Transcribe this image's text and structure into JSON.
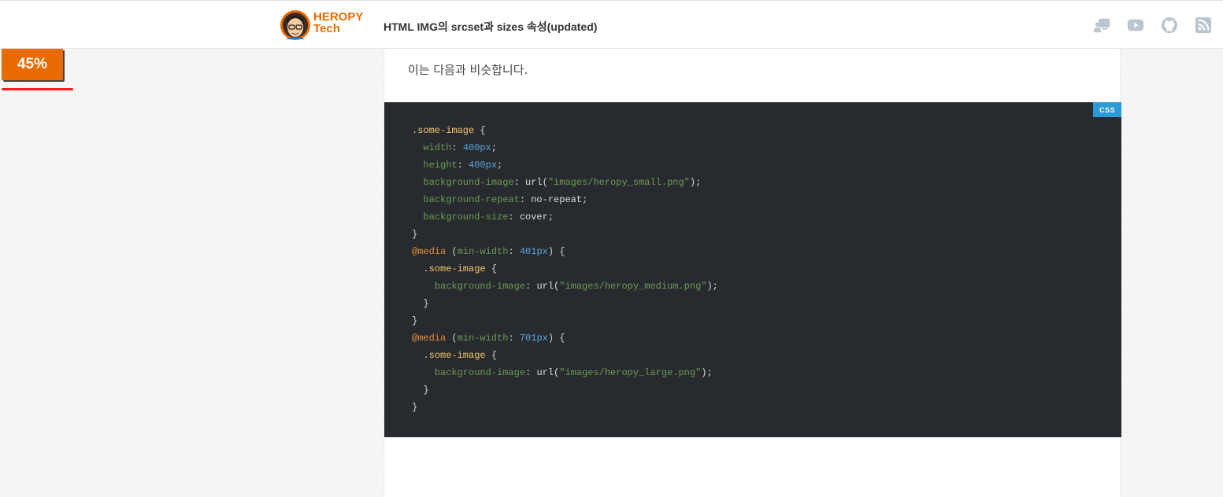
{
  "site": {
    "brand_line1": "HEROPY",
    "brand_line2": "Tech",
    "brand_color": "#e86b00"
  },
  "header": {
    "title": "HTML IMG의 srcset과 sizes 속성(updated)"
  },
  "nav_icons": [
    "presentation-icon",
    "youtube-icon",
    "github-icon",
    "rss-icon"
  ],
  "progress": {
    "label": "45%",
    "value": 45
  },
  "content": {
    "intro": "이는 다음과 비슷합니다.",
    "code": {
      "lang": "CSS",
      "lines": [
        [
          {
            "t": ".some-image",
            "c": "sel"
          },
          {
            "t": " {",
            "c": "pun"
          }
        ],
        [
          {
            "t": "  width",
            "c": "prop"
          },
          {
            "t": ": ",
            "c": "pun"
          },
          {
            "t": "400px",
            "c": "num"
          },
          {
            "t": ";",
            "c": "pun"
          }
        ],
        [
          {
            "t": "  height",
            "c": "prop"
          },
          {
            "t": ": ",
            "c": "pun"
          },
          {
            "t": "400px",
            "c": "num"
          },
          {
            "t": ";",
            "c": "pun"
          }
        ],
        [
          {
            "t": "  background-image",
            "c": "prop"
          },
          {
            "t": ": ",
            "c": "pun"
          },
          {
            "t": "url(",
            "c": "fn"
          },
          {
            "t": "\"images/heropy_small.png\"",
            "c": "str"
          },
          {
            "t": ");",
            "c": "pun"
          }
        ],
        [
          {
            "t": "  background-repeat",
            "c": "prop"
          },
          {
            "t": ": ",
            "c": "pun"
          },
          {
            "t": "no-repeat",
            "c": "fn"
          },
          {
            "t": ";",
            "c": "pun"
          }
        ],
        [
          {
            "t": "  background-size",
            "c": "prop"
          },
          {
            "t": ": ",
            "c": "pun"
          },
          {
            "t": "cover",
            "c": "fn"
          },
          {
            "t": ";",
            "c": "pun"
          }
        ],
        [
          {
            "t": "}",
            "c": "pun"
          }
        ],
        [
          {
            "t": "@media",
            "c": "kw"
          },
          {
            "t": " (",
            "c": "pun"
          },
          {
            "t": "min-width",
            "c": "prop"
          },
          {
            "t": ": ",
            "c": "pun"
          },
          {
            "t": "401px",
            "c": "num"
          },
          {
            "t": ") {",
            "c": "pun"
          }
        ],
        [
          {
            "t": "  .some-image",
            "c": "sel"
          },
          {
            "t": " {",
            "c": "pun"
          }
        ],
        [
          {
            "t": "    background-image",
            "c": "prop"
          },
          {
            "t": ": ",
            "c": "pun"
          },
          {
            "t": "url(",
            "c": "fn"
          },
          {
            "t": "\"images/heropy_medium.png\"",
            "c": "str"
          },
          {
            "t": ");",
            "c": "pun"
          }
        ],
        [
          {
            "t": "  }",
            "c": "pun"
          }
        ],
        [
          {
            "t": "}",
            "c": "pun"
          }
        ],
        [
          {
            "t": "@media",
            "c": "kw"
          },
          {
            "t": " (",
            "c": "pun"
          },
          {
            "t": "min-width",
            "c": "prop"
          },
          {
            "t": ": ",
            "c": "pun"
          },
          {
            "t": "701px",
            "c": "num"
          },
          {
            "t": ") {",
            "c": "pun"
          }
        ],
        [
          {
            "t": "  .some-image",
            "c": "sel"
          },
          {
            "t": " {",
            "c": "pun"
          }
        ],
        [
          {
            "t": "    background-image",
            "c": "prop"
          },
          {
            "t": ": ",
            "c": "pun"
          },
          {
            "t": "url(",
            "c": "fn"
          },
          {
            "t": "\"images/heropy_large.png\"",
            "c": "str"
          },
          {
            "t": ");",
            "c": "pun"
          }
        ],
        [
          {
            "t": "  }",
            "c": "pun"
          }
        ],
        [
          {
            "t": "}",
            "c": "pun"
          }
        ]
      ]
    }
  }
}
